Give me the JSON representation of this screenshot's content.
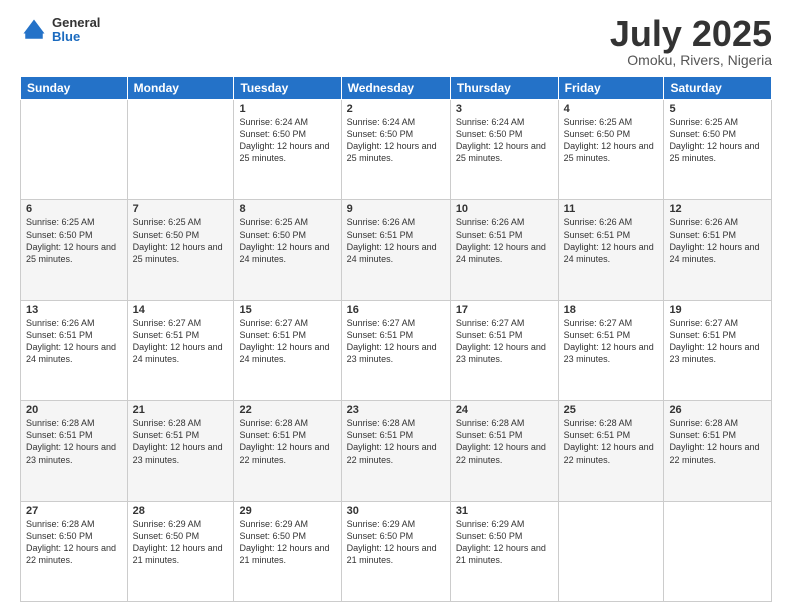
{
  "header": {
    "logo": {
      "general": "General",
      "blue": "Blue"
    },
    "title": "July 2025",
    "location": "Omoku, Rivers, Nigeria"
  },
  "weekdays": [
    "Sunday",
    "Monday",
    "Tuesday",
    "Wednesday",
    "Thursday",
    "Friday",
    "Saturday"
  ],
  "weeks": [
    [
      {
        "day": "",
        "sunrise": "",
        "sunset": "",
        "daylight": ""
      },
      {
        "day": "",
        "sunrise": "",
        "sunset": "",
        "daylight": ""
      },
      {
        "day": "1",
        "sunrise": "Sunrise: 6:24 AM",
        "sunset": "Sunset: 6:50 PM",
        "daylight": "Daylight: 12 hours and 25 minutes."
      },
      {
        "day": "2",
        "sunrise": "Sunrise: 6:24 AM",
        "sunset": "Sunset: 6:50 PM",
        "daylight": "Daylight: 12 hours and 25 minutes."
      },
      {
        "day": "3",
        "sunrise": "Sunrise: 6:24 AM",
        "sunset": "Sunset: 6:50 PM",
        "daylight": "Daylight: 12 hours and 25 minutes."
      },
      {
        "day": "4",
        "sunrise": "Sunrise: 6:25 AM",
        "sunset": "Sunset: 6:50 PM",
        "daylight": "Daylight: 12 hours and 25 minutes."
      },
      {
        "day": "5",
        "sunrise": "Sunrise: 6:25 AM",
        "sunset": "Sunset: 6:50 PM",
        "daylight": "Daylight: 12 hours and 25 minutes."
      }
    ],
    [
      {
        "day": "6",
        "sunrise": "Sunrise: 6:25 AM",
        "sunset": "Sunset: 6:50 PM",
        "daylight": "Daylight: 12 hours and 25 minutes."
      },
      {
        "day": "7",
        "sunrise": "Sunrise: 6:25 AM",
        "sunset": "Sunset: 6:50 PM",
        "daylight": "Daylight: 12 hours and 25 minutes."
      },
      {
        "day": "8",
        "sunrise": "Sunrise: 6:25 AM",
        "sunset": "Sunset: 6:50 PM",
        "daylight": "Daylight: 12 hours and 24 minutes."
      },
      {
        "day": "9",
        "sunrise": "Sunrise: 6:26 AM",
        "sunset": "Sunset: 6:51 PM",
        "daylight": "Daylight: 12 hours and 24 minutes."
      },
      {
        "day": "10",
        "sunrise": "Sunrise: 6:26 AM",
        "sunset": "Sunset: 6:51 PM",
        "daylight": "Daylight: 12 hours and 24 minutes."
      },
      {
        "day": "11",
        "sunrise": "Sunrise: 6:26 AM",
        "sunset": "Sunset: 6:51 PM",
        "daylight": "Daylight: 12 hours and 24 minutes."
      },
      {
        "day": "12",
        "sunrise": "Sunrise: 6:26 AM",
        "sunset": "Sunset: 6:51 PM",
        "daylight": "Daylight: 12 hours and 24 minutes."
      }
    ],
    [
      {
        "day": "13",
        "sunrise": "Sunrise: 6:26 AM",
        "sunset": "Sunset: 6:51 PM",
        "daylight": "Daylight: 12 hours and 24 minutes."
      },
      {
        "day": "14",
        "sunrise": "Sunrise: 6:27 AM",
        "sunset": "Sunset: 6:51 PM",
        "daylight": "Daylight: 12 hours and 24 minutes."
      },
      {
        "day": "15",
        "sunrise": "Sunrise: 6:27 AM",
        "sunset": "Sunset: 6:51 PM",
        "daylight": "Daylight: 12 hours and 24 minutes."
      },
      {
        "day": "16",
        "sunrise": "Sunrise: 6:27 AM",
        "sunset": "Sunset: 6:51 PM",
        "daylight": "Daylight: 12 hours and 23 minutes."
      },
      {
        "day": "17",
        "sunrise": "Sunrise: 6:27 AM",
        "sunset": "Sunset: 6:51 PM",
        "daylight": "Daylight: 12 hours and 23 minutes."
      },
      {
        "day": "18",
        "sunrise": "Sunrise: 6:27 AM",
        "sunset": "Sunset: 6:51 PM",
        "daylight": "Daylight: 12 hours and 23 minutes."
      },
      {
        "day": "19",
        "sunrise": "Sunrise: 6:27 AM",
        "sunset": "Sunset: 6:51 PM",
        "daylight": "Daylight: 12 hours and 23 minutes."
      }
    ],
    [
      {
        "day": "20",
        "sunrise": "Sunrise: 6:28 AM",
        "sunset": "Sunset: 6:51 PM",
        "daylight": "Daylight: 12 hours and 23 minutes."
      },
      {
        "day": "21",
        "sunrise": "Sunrise: 6:28 AM",
        "sunset": "Sunset: 6:51 PM",
        "daylight": "Daylight: 12 hours and 23 minutes."
      },
      {
        "day": "22",
        "sunrise": "Sunrise: 6:28 AM",
        "sunset": "Sunset: 6:51 PM",
        "daylight": "Daylight: 12 hours and 22 minutes."
      },
      {
        "day": "23",
        "sunrise": "Sunrise: 6:28 AM",
        "sunset": "Sunset: 6:51 PM",
        "daylight": "Daylight: 12 hours and 22 minutes."
      },
      {
        "day": "24",
        "sunrise": "Sunrise: 6:28 AM",
        "sunset": "Sunset: 6:51 PM",
        "daylight": "Daylight: 12 hours and 22 minutes."
      },
      {
        "day": "25",
        "sunrise": "Sunrise: 6:28 AM",
        "sunset": "Sunset: 6:51 PM",
        "daylight": "Daylight: 12 hours and 22 minutes."
      },
      {
        "day": "26",
        "sunrise": "Sunrise: 6:28 AM",
        "sunset": "Sunset: 6:51 PM",
        "daylight": "Daylight: 12 hours and 22 minutes."
      }
    ],
    [
      {
        "day": "27",
        "sunrise": "Sunrise: 6:28 AM",
        "sunset": "Sunset: 6:50 PM",
        "daylight": "Daylight: 12 hours and 22 minutes."
      },
      {
        "day": "28",
        "sunrise": "Sunrise: 6:29 AM",
        "sunset": "Sunset: 6:50 PM",
        "daylight": "Daylight: 12 hours and 21 minutes."
      },
      {
        "day": "29",
        "sunrise": "Sunrise: 6:29 AM",
        "sunset": "Sunset: 6:50 PM",
        "daylight": "Daylight: 12 hours and 21 minutes."
      },
      {
        "day": "30",
        "sunrise": "Sunrise: 6:29 AM",
        "sunset": "Sunset: 6:50 PM",
        "daylight": "Daylight: 12 hours and 21 minutes."
      },
      {
        "day": "31",
        "sunrise": "Sunrise: 6:29 AM",
        "sunset": "Sunset: 6:50 PM",
        "daylight": "Daylight: 12 hours and 21 minutes."
      },
      {
        "day": "",
        "sunrise": "",
        "sunset": "",
        "daylight": ""
      },
      {
        "day": "",
        "sunrise": "",
        "sunset": "",
        "daylight": ""
      }
    ]
  ]
}
